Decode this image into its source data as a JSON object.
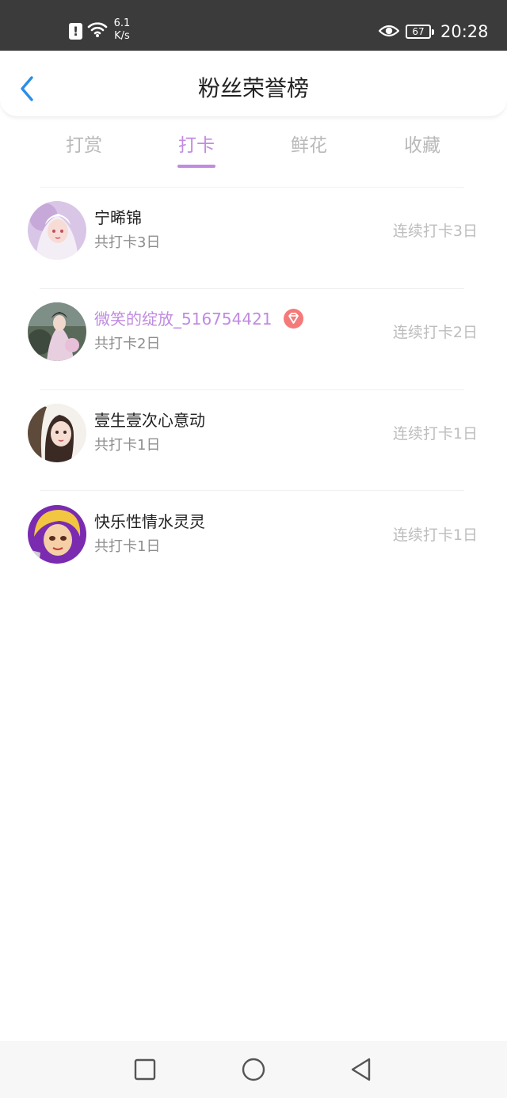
{
  "status_bar": {
    "alert_icon": "!",
    "net_speed_value": "6.1",
    "net_speed_unit": "K/s",
    "battery": "67",
    "time": "20:28"
  },
  "header": {
    "title": "粉丝荣誉榜"
  },
  "tabs": [
    {
      "label": "打赏",
      "active": false
    },
    {
      "label": "打卡",
      "active": true
    },
    {
      "label": "鲜花",
      "active": false
    },
    {
      "label": "收藏",
      "active": false
    }
  ],
  "colors": {
    "accent": "#c08be0",
    "back": "#2b8ee6",
    "vip_badge": "#f47a7a"
  },
  "fans": [
    {
      "name": "宁晞锦",
      "total": "共打卡3日",
      "streak": "连续打卡3日",
      "vip": false
    },
    {
      "name": "微笑的绽放_516754421",
      "total": "共打卡2日",
      "streak": "连续打卡2日",
      "vip": true
    },
    {
      "name": "壹生壹次心意动",
      "total": "共打卡1日",
      "streak": "连续打卡1日",
      "vip": false
    },
    {
      "name": "快乐性情水灵灵",
      "total": "共打卡1日",
      "streak": "连续打卡1日",
      "vip": false
    }
  ]
}
